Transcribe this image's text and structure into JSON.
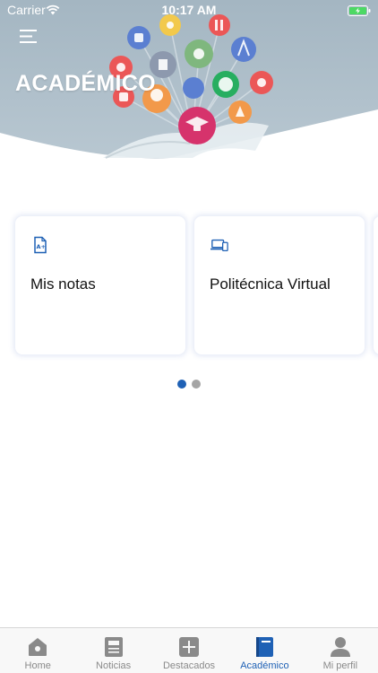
{
  "status_bar": {
    "carrier": "Carrier",
    "time": "10:17 AM"
  },
  "header": {
    "title": "ACADÉMICO"
  },
  "cards": [
    {
      "label": "Mis notas",
      "icon": "grade-document-icon"
    },
    {
      "label": "Politécnica Virtual",
      "icon": "laptop-phone-icon"
    },
    {
      "label": "",
      "icon": ""
    }
  ],
  "pager": {
    "count": 2,
    "active_index": 0
  },
  "tab_bar": {
    "active": "Académico",
    "items": [
      {
        "label": "Home",
        "icon": "home-icon"
      },
      {
        "label": "Noticias",
        "icon": "news-icon"
      },
      {
        "label": "Destacados",
        "icon": "plus-icon"
      },
      {
        "label": "Académico",
        "icon": "book-icon"
      },
      {
        "label": "Mi perfil",
        "icon": "user-icon"
      }
    ]
  },
  "colors": {
    "accent": "#1f61b5",
    "inactive": "#8a8a8a",
    "header_bg": "#a9b9c4"
  }
}
